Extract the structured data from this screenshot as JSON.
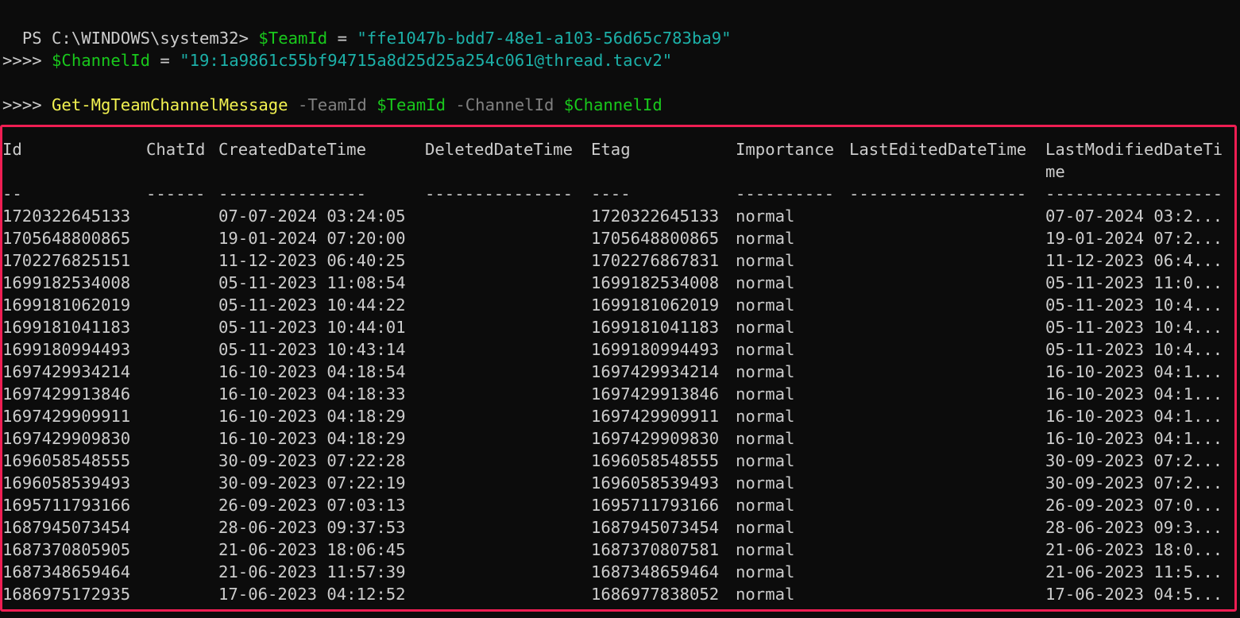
{
  "console": {
    "top_overflow": "                    ...",
    "prompt": "PS C:\\WINDOWS\\system32> ",
    "line1_var": "$TeamId",
    "line1_eq": " = ",
    "line1_value": "\"ffe1047b-bdd7-48e1-a103-56d65c783ba9\"",
    "cont": ">> ",
    "line2_var": "$ChannelId",
    "line2_eq": " = ",
    "line2_value": "\"19:1a9861c55bf94715a8d25d25a254c061@thread.tacv2\"",
    "line3": ">>",
    "cmdlet": "Get-MgTeamChannelMessage",
    "param1": " -TeamId ",
    "param1_value": "$TeamId",
    "param2": " -ChannelId ",
    "param2_value": "$ChannelId",
    "line5": ">>"
  },
  "table": {
    "headers": {
      "id": "Id",
      "chat": "ChatId",
      "created": "CreatedDateTime",
      "deleted": "DeletedDateTime",
      "etag": "Etag",
      "importance": "Importance",
      "lastedited": "LastEditedDateTime",
      "lastmod1": "LastModifiedDateTi",
      "lastmod2": "me"
    },
    "separators": {
      "id": "--",
      "chat": "------",
      "created": "---------------",
      "deleted": "---------------",
      "etag": "----",
      "importance": "----------",
      "lastedited": "------------------",
      "lastmod": "------------------"
    },
    "rows": [
      {
        "id": "1720322645133",
        "created": "07-07-2024 03:24:05",
        "etag": "1720322645133",
        "importance": "normal",
        "lastmod": "07-07-2024 03:2..."
      },
      {
        "id": "1705648800865",
        "created": "19-01-2024 07:20:00",
        "etag": "1705648800865",
        "importance": "normal",
        "lastmod": "19-01-2024 07:2..."
      },
      {
        "id": "1702276825151",
        "created": "11-12-2023 06:40:25",
        "etag": "1702276867831",
        "importance": "normal",
        "lastmod": "11-12-2023 06:4..."
      },
      {
        "id": "1699182534008",
        "created": "05-11-2023 11:08:54",
        "etag": "1699182534008",
        "importance": "normal",
        "lastmod": "05-11-2023 11:0..."
      },
      {
        "id": "1699181062019",
        "created": "05-11-2023 10:44:22",
        "etag": "1699181062019",
        "importance": "normal",
        "lastmod": "05-11-2023 10:4..."
      },
      {
        "id": "1699181041183",
        "created": "05-11-2023 10:44:01",
        "etag": "1699181041183",
        "importance": "normal",
        "lastmod": "05-11-2023 10:4..."
      },
      {
        "id": "1699180994493",
        "created": "05-11-2023 10:43:14",
        "etag": "1699180994493",
        "importance": "normal",
        "lastmod": "05-11-2023 10:4..."
      },
      {
        "id": "1697429934214",
        "created": "16-10-2023 04:18:54",
        "etag": "1697429934214",
        "importance": "normal",
        "lastmod": "16-10-2023 04:1..."
      },
      {
        "id": "1697429913846",
        "created": "16-10-2023 04:18:33",
        "etag": "1697429913846",
        "importance": "normal",
        "lastmod": "16-10-2023 04:1..."
      },
      {
        "id": "1697429909911",
        "created": "16-10-2023 04:18:29",
        "etag": "1697429909911",
        "importance": "normal",
        "lastmod": "16-10-2023 04:1..."
      },
      {
        "id": "1697429909830",
        "created": "16-10-2023 04:18:29",
        "etag": "1697429909830",
        "importance": "normal",
        "lastmod": "16-10-2023 04:1..."
      },
      {
        "id": "1696058548555",
        "created": "30-09-2023 07:22:28",
        "etag": "1696058548555",
        "importance": "normal",
        "lastmod": "30-09-2023 07:2..."
      },
      {
        "id": "1696058539493",
        "created": "30-09-2023 07:22:19",
        "etag": "1696058539493",
        "importance": "normal",
        "lastmod": "30-09-2023 07:2..."
      },
      {
        "id": "1695711793166",
        "created": "26-09-2023 07:03:13",
        "etag": "1695711793166",
        "importance": "normal",
        "lastmod": "26-09-2023 07:0..."
      },
      {
        "id": "1687945073454",
        "created": "28-06-2023 09:37:53",
        "etag": "1687945073454",
        "importance": "normal",
        "lastmod": "28-06-2023 09:3..."
      },
      {
        "id": "1687370805905",
        "created": "21-06-2023 18:06:45",
        "etag": "1687370807581",
        "importance": "normal",
        "lastmod": "21-06-2023 18:0..."
      },
      {
        "id": "1687348659464",
        "created": "21-06-2023 11:57:39",
        "etag": "1687348659464",
        "importance": "normal",
        "lastmod": "21-06-2023 11:5..."
      },
      {
        "id": "1686975172935",
        "created": "17-06-2023 04:12:52",
        "etag": "1686977838052",
        "importance": "normal",
        "lastmod": "17-06-2023 04:5..."
      }
    ]
  },
  "colors": {
    "background": "#0c0c0c",
    "text": "#cccccc",
    "string": "#1cb0a8",
    "variable": "#19c81c",
    "cmdlet": "#f2f250",
    "parameter": "#808080",
    "highlight_frame": "#ef1e53"
  }
}
